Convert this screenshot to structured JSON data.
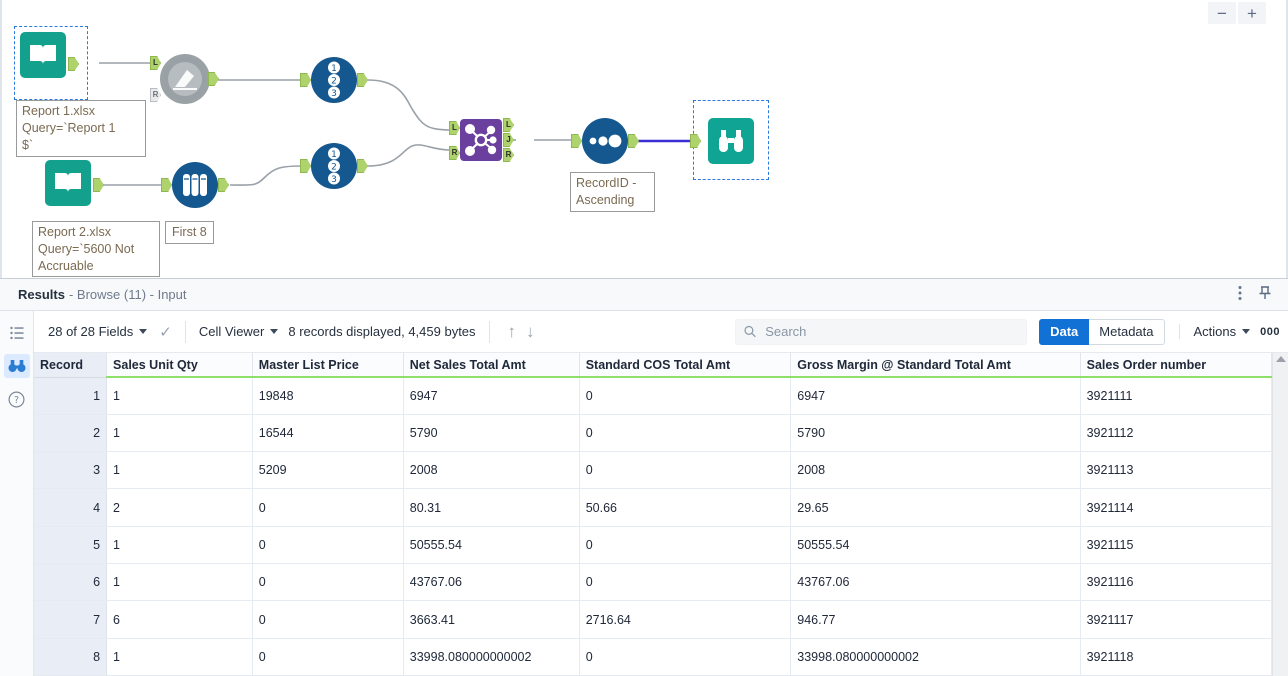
{
  "canvas": {
    "zoom_out_label": "−",
    "zoom_in_label": "+",
    "annotations": {
      "input1": "Report 1.xlsx\nQuery=`Report 1\n$`",
      "input2": "Report 2.xlsx\nQuery=`5600 Not\nAccruable",
      "sample": "First 8",
      "sort": "RecordID -\nAscending"
    },
    "ports": {
      "left": "L",
      "right": "R",
      "join": "J"
    },
    "tools": [
      {
        "name": "input-data-tool-1",
        "icon": "book-icon",
        "selected": true
      },
      {
        "name": "join-tool-disabled",
        "icon": "gear-pen-icon",
        "selected": false
      },
      {
        "name": "record-id-tool-1",
        "icon": "record-id-icon",
        "selected": false
      },
      {
        "name": "input-data-tool-2",
        "icon": "book-icon",
        "selected": false
      },
      {
        "name": "sample-tool",
        "icon": "test-tubes-icon",
        "selected": false
      },
      {
        "name": "record-id-tool-2",
        "icon": "record-id-icon",
        "selected": false
      },
      {
        "name": "join-tool",
        "icon": "join-icon",
        "selected": false
      },
      {
        "name": "sort-tool",
        "icon": "sort-dots-icon",
        "selected": false
      },
      {
        "name": "browse-tool",
        "icon": "binoculars-icon",
        "selected": true
      }
    ]
  },
  "results": {
    "title": "Results",
    "subtitle": "- Browse (11) - Input",
    "toolbar": {
      "fields_label": "28 of 28 Fields",
      "viewer_label": "Cell Viewer",
      "records_label": "8 records displayed, 4,459 bytes",
      "search_placeholder": "Search",
      "data_tab": "Data",
      "metadata_tab": "Metadata",
      "actions_label": "Actions",
      "overflow_label": "000"
    },
    "table": {
      "columns": [
        "Record",
        "Sales Unit Qty",
        "Master List Price",
        "Net Sales Total Amt",
        "Standard COS Total Amt",
        "Gross Margin @ Standard Total Amt",
        "Sales Order number"
      ],
      "rows": [
        [
          "1",
          "1",
          "19848",
          "6947",
          "0",
          "6947",
          "3921111"
        ],
        [
          "2",
          "1",
          "16544",
          "5790",
          "0",
          "5790",
          "3921112"
        ],
        [
          "3",
          "1",
          "5209",
          "2008",
          "0",
          "2008",
          "3921113"
        ],
        [
          "4",
          "2",
          "0",
          "80.31",
          "50.66",
          "29.65",
          "3921114"
        ],
        [
          "5",
          "1",
          "0",
          "50555.54",
          "0",
          "50555.54",
          "3921115"
        ],
        [
          "6",
          "1",
          "0",
          "43767.06",
          "0",
          "43767.06",
          "3921116"
        ],
        [
          "7",
          "6",
          "0",
          "3663.41",
          "2716.64",
          "946.77",
          "3921117"
        ],
        [
          "8",
          "1",
          "0",
          "33998.080000000002",
          "0",
          "33998.080000000002",
          "3921118"
        ]
      ]
    }
  },
  "colors": {
    "teal": "#13a18e",
    "blue_node": "#15578f",
    "purple": "#6b3f9e",
    "port_green": "#aed36c",
    "accent_blue": "#1271d4",
    "header_green": "#8fe06a"
  }
}
